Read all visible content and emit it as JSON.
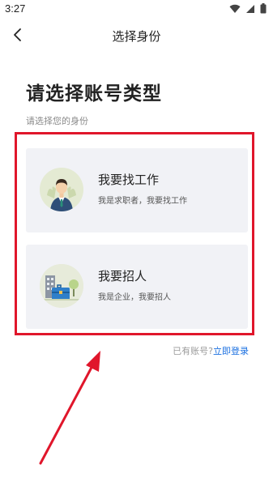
{
  "status_bar": {
    "time": "3:27",
    "icons": [
      "wifi-icon",
      "signal-icon",
      "battery-icon"
    ]
  },
  "nav": {
    "back_icon": "chevron-left-icon",
    "title": "选择身份"
  },
  "heading": "请选择账号类型",
  "subtitle": "请选择您的身份",
  "cards": [
    {
      "title": "我要找工作",
      "description": "我是求职者，我要找工作",
      "icon": "job-seeker-avatar-icon"
    },
    {
      "title": "我要招人",
      "description": "我是企业，我要招人",
      "icon": "company-briefcase-icon"
    }
  ],
  "login": {
    "prompt": "已有账号?",
    "link": "立即登录"
  },
  "colors": {
    "highlight_red": "#e0162b",
    "card_bg": "#f1f2f6",
    "link_blue": "#1a6fe0",
    "subtitle_gray": "#8a8a8a"
  }
}
